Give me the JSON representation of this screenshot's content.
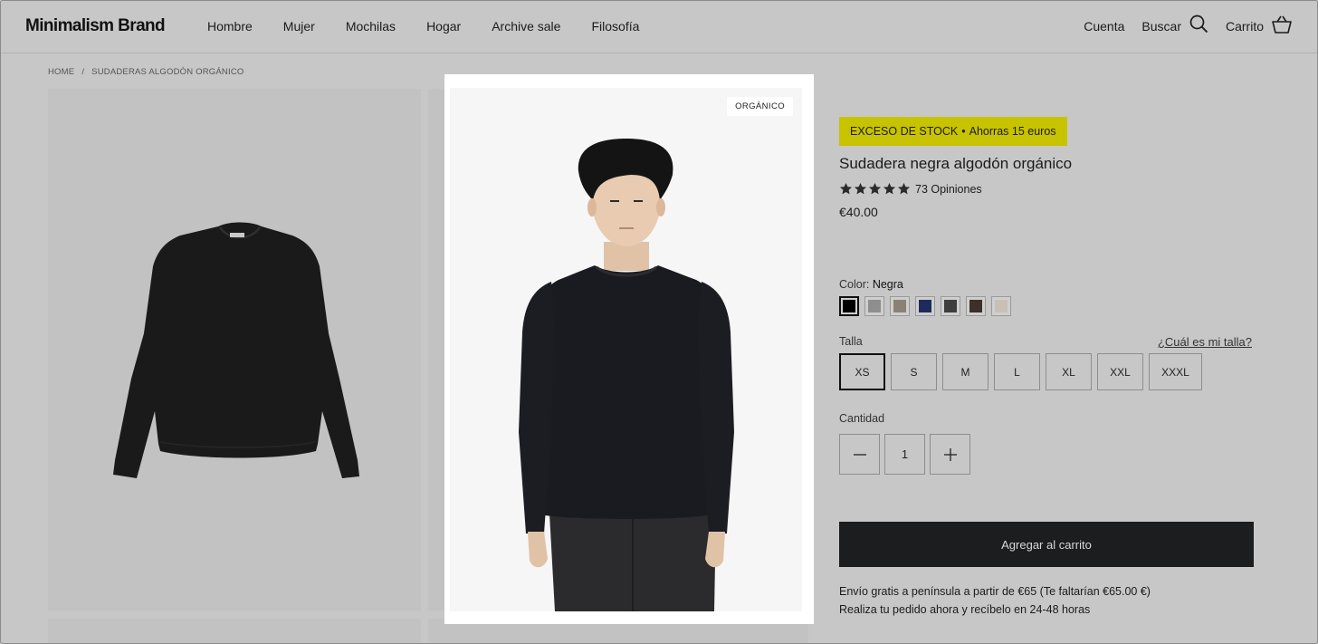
{
  "header": {
    "brand": "Minimalism Brand",
    "nav": [
      "Hombre",
      "Mujer",
      "Mochilas",
      "Hogar",
      "Archive sale",
      "Filosofía"
    ],
    "account": "Cuenta",
    "search": "Buscar",
    "cart": "Carrito"
  },
  "breadcrumb": {
    "home": "HOME",
    "separator": "/",
    "current": "SUDADERAS ALGODÓN ORGÁNICO"
  },
  "gallery": {
    "badge": "ORGÁNICO"
  },
  "product": {
    "stock_badge_main": "EXCESO DE STOCK",
    "stock_badge_dot": "•",
    "stock_badge_savings": "Ahorras 15 euros",
    "title": "Sudadera negra algodón orgánico",
    "rating": 5,
    "reviews": "73 Opiniones",
    "price": "€40.00",
    "color_label": "Color",
    "color_selected": "Negra",
    "swatches": [
      "#000000",
      "#8e8e8e",
      "#8a8274",
      "#1f2a5c",
      "#3e3e3e",
      "#3d2f2a",
      "#c9bfb5"
    ],
    "size_label": "Talla",
    "size_guide": "¿Cuál es mi talla?",
    "sizes": [
      "XS",
      "S",
      "M",
      "L",
      "XL",
      "XXL",
      "XXXL"
    ],
    "size_selected": "XS",
    "quantity_label": "Cantidad",
    "quantity": "1",
    "add_to_cart": "Agregar al carrito",
    "shipping_line1": "Envío gratis a península a partir de €65 (Te faltarían €65.00 €)",
    "shipping_line2": "Realiza tu pedido ahora y recíbelo en 24-48 horas"
  },
  "colors": {
    "stock_badge": "#c8c300",
    "overlay": "#c7c7c7",
    "button": "#1b1d1e"
  }
}
